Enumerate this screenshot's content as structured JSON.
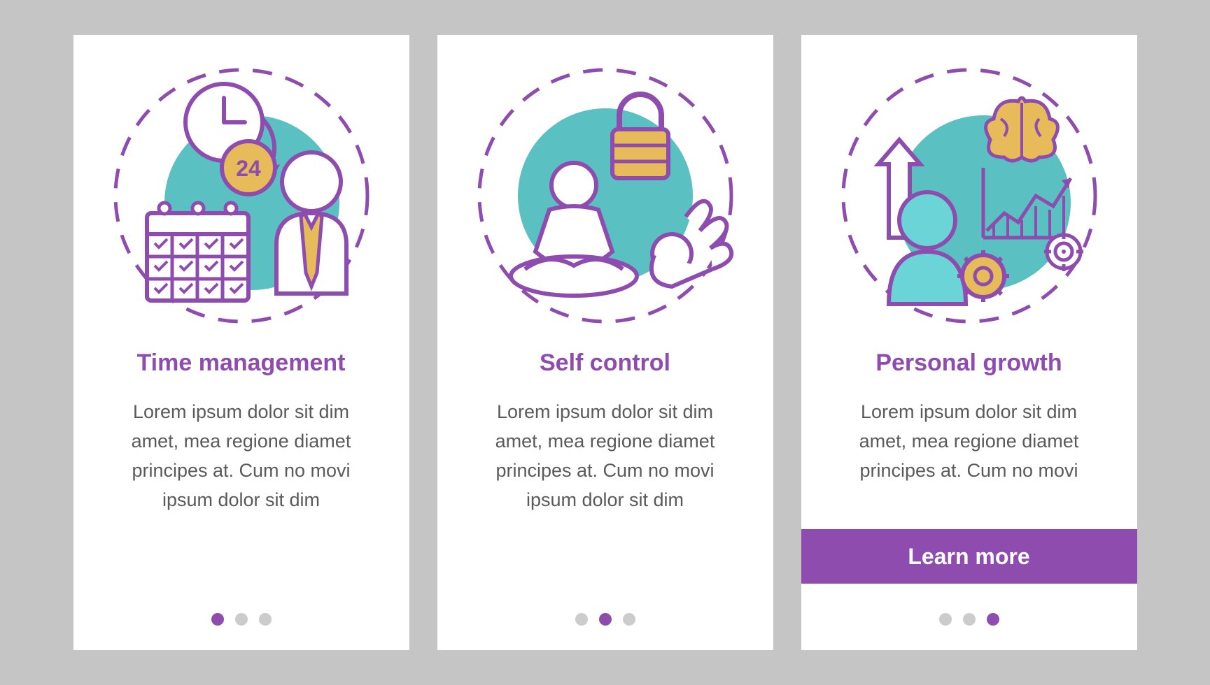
{
  "colors": {
    "accent": "#8e4caf",
    "teal": "#5ac0c2",
    "yellow": "#e7bb5a",
    "gray": "#cccccc",
    "text": "#5a5a5a"
  },
  "cards": [
    {
      "icon": "time-management-icon",
      "title": "Time management",
      "body": "Lorem ipsum dolor sit dim amet, mea regione diamet principes at. Cum no movi ipsum dolor sit dim",
      "activeDot": 0,
      "cta": null,
      "badge": "24"
    },
    {
      "icon": "self-control-icon",
      "title": "Self control",
      "body": "Lorem ipsum dolor sit dim amet, mea regione diamet principes at. Cum no movi ipsum dolor sit dim",
      "activeDot": 1,
      "cta": null
    },
    {
      "icon": "personal-growth-icon",
      "title": "Personal growth",
      "body": "Lorem ipsum dolor sit dim amet, mea regione diamet principes at. Cum no movi",
      "activeDot": 2,
      "cta": "Learn more"
    }
  ]
}
